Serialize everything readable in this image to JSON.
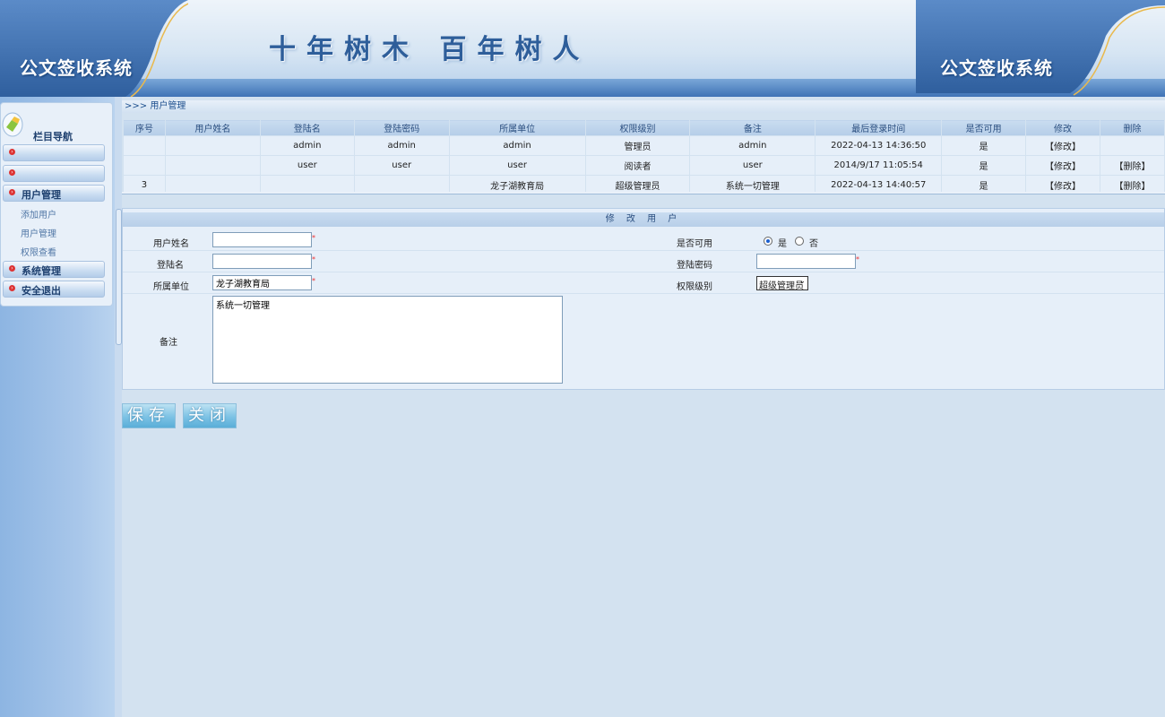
{
  "header": {
    "system_name_left": "公文签收系统",
    "slogan": "十年树木 百年树人",
    "system_name_right": "公文签收系统"
  },
  "sidebar": {
    "title": "栏目导航",
    "sections": [
      {
        "label": ""
      },
      {
        "label": ""
      },
      {
        "label": "用户管理",
        "expanded": true,
        "children": [
          "添加用户",
          "用户管理",
          "权限查看"
        ]
      },
      {
        "label": "系统管理"
      },
      {
        "label": "安全退出"
      }
    ]
  },
  "breadcrumb": ">>> 用户管理",
  "table": {
    "columns": [
      "序号",
      "用户姓名",
      "登陆名",
      "登陆密码",
      "所属单位",
      "权限级别",
      "备注",
      "最后登录时间",
      "是否可用",
      "修改",
      "删除"
    ],
    "rows": [
      {
        "id": "",
        "name": "",
        "login": "admin",
        "password": "admin",
        "unit": "admin",
        "level": "管理员",
        "remark": "admin",
        "last_login": "2022-04-13 14:36:50",
        "enabled": "是",
        "edit": "【修改】",
        "delete": ""
      },
      {
        "id": "",
        "name": "",
        "login": "user",
        "password": "user",
        "unit": "user",
        "level": "阅读者",
        "remark": "user",
        "last_login": "2014/9/17 11:05:54",
        "enabled": "是",
        "edit": "【修改】",
        "delete": "【删除】"
      },
      {
        "id": "3",
        "name": "",
        "login": "",
        "password": "",
        "unit": "龙子湖教育局",
        "level": "超级管理员",
        "remark": "系统一切管理",
        "last_login": "2022-04-13 14:40:57",
        "enabled": "是",
        "edit": "【修改】",
        "delete": "【删除】"
      }
    ]
  },
  "form": {
    "title": "修 改 用 户",
    "labels": {
      "name": "用户姓名",
      "login": "登陆名",
      "unit": "所属单位",
      "remark": "备注",
      "enabled": "是否可用",
      "password": "登陆密码",
      "level": "权限级别"
    },
    "values": {
      "name": "",
      "login": "",
      "unit": "龙子湖教育局",
      "remark": "系统一切管理",
      "password": "",
      "level": "超级管理员"
    },
    "required_mark": "*",
    "enabled_options": {
      "yes": "是",
      "no": "否",
      "selected": "是"
    }
  },
  "buttons": {
    "save": "保存",
    "close": "关闭"
  },
  "colors": {
    "header_blue": "#3f73b6",
    "enabled_green": "#1f9a1f",
    "delete_red": "#d41c1c"
  }
}
